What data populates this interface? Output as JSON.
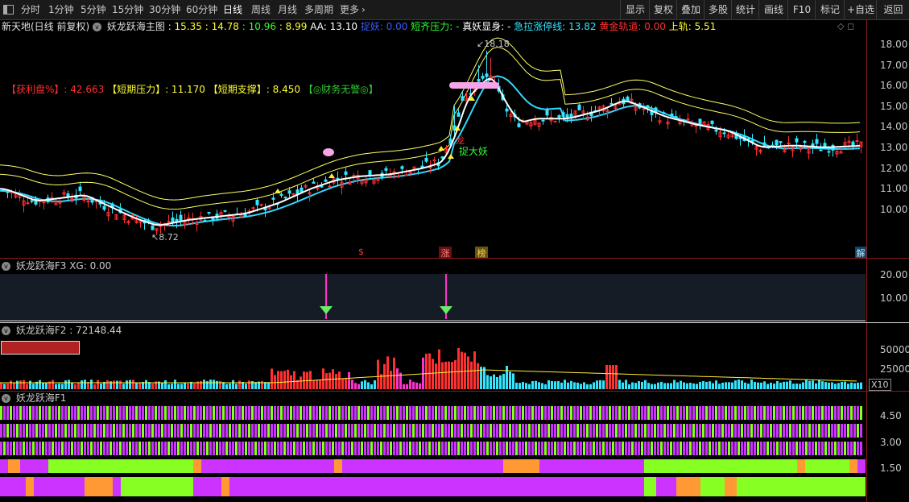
{
  "toolbar": {
    "periods": [
      "分时",
      "1分钟",
      "5分钟",
      "15分钟",
      "30分钟",
      "60分钟",
      "日线",
      "周线",
      "月线",
      "多周期",
      "更多"
    ],
    "active_period": "日线",
    "more_arrow": "chevron-right-icon",
    "right_buttons": [
      "显示",
      "复权",
      "叠加",
      "多股",
      "统计",
      "画线",
      "F10",
      "标记",
      "+自选",
      "返回"
    ]
  },
  "main_header": {
    "stock": "新天地(日线 前复权)",
    "indicator": "妖龙跃海主图",
    "v1": ": 15.35",
    "v2": ": 14.78",
    "v3": ": 10.96",
    "v4": ": 8.99",
    "aa": "AA: 13.10",
    "catch_label": "捉妖: 0.00",
    "short_pressure": "短齐压力: -",
    "true_demon": "真妖显身: -",
    "limit_up_line": "急拉涨停线: 13.82",
    "golden_track": "黄金轨道: 0.00",
    "upper_track": "上轨: 5.51"
  },
  "info_line": {
    "profit": "【获利盘%】: 42.663",
    "short_pressure": "【短期压力】: 11.170",
    "short_support": "【短期支撑】: 8.450",
    "warning": "【◎财务无警◎】"
  },
  "annotations": {
    "high": "18.18",
    "low": "8.72",
    "catch_big_demon": "捉大妖",
    "dragon": "龙",
    "marker_s": "$",
    "marker_zhang": "涨",
    "marker_bang": "榜",
    "marker_jie": "解"
  },
  "main_axis": [
    "18.00",
    "17.00",
    "16.00",
    "15.00",
    "14.00",
    "13.00",
    "12.00",
    "11.00",
    "10.00"
  ],
  "f3_panel": {
    "title": "妖龙跃海F3",
    "xg": "XG: 0.00",
    "axis": [
      "20.00",
      "10.00"
    ]
  },
  "f2_panel": {
    "title": "妖龙跃海F2",
    "value": ": 72148.44",
    "axis": [
      "50000",
      "25000"
    ],
    "unit": "X10"
  },
  "f1_panel": {
    "title": "妖龙跃海F1",
    "axis": [
      "4.50",
      "3.00",
      "1.50"
    ]
  },
  "colors": {
    "up": "#ff3030",
    "down": "#33e6ff",
    "ma": "#ffffff",
    "band": "#ffff66",
    "mid": "#33d6ff",
    "purple": "#cc33ff",
    "green": "#88ff22",
    "orange": "#ff9933",
    "magenta": "#ff33cc"
  }
}
